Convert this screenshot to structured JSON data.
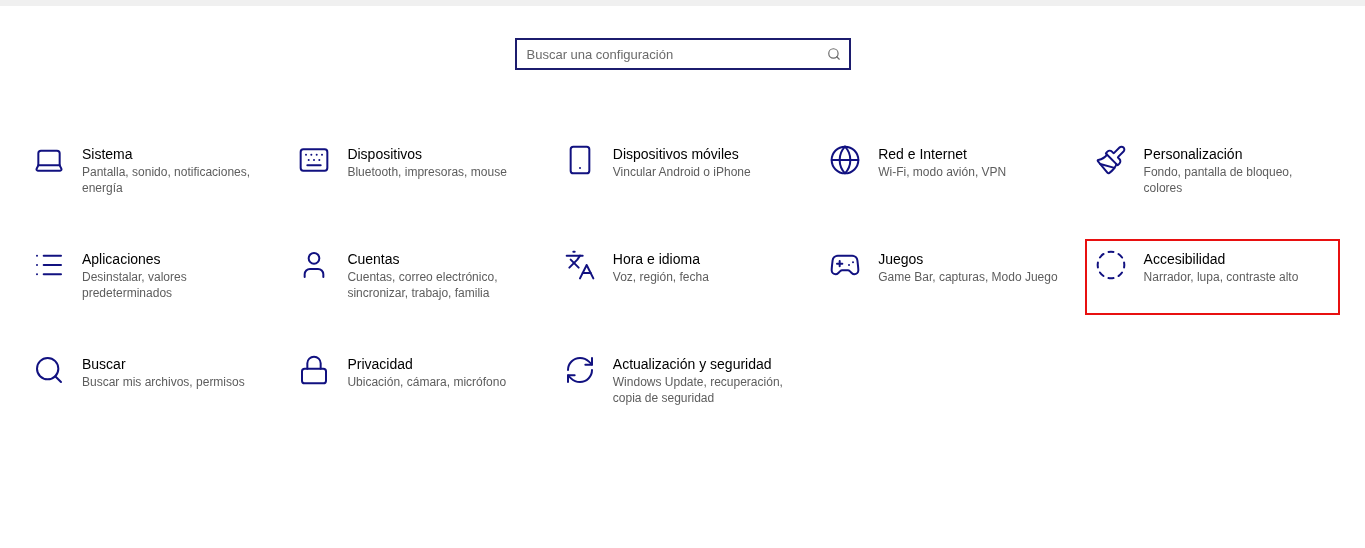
{
  "search": {
    "placeholder": "Buscar una configuración"
  },
  "categories": [
    {
      "title": "Sistema",
      "description": "Pantalla, sonido, notificaciones, energía",
      "highlighted": false
    },
    {
      "title": "Dispositivos",
      "description": "Bluetooth, impresoras, mouse",
      "highlighted": false
    },
    {
      "title": "Dispositivos móviles",
      "description": "Vincular Android o iPhone",
      "highlighted": false
    },
    {
      "title": "Red e Internet",
      "description": "Wi-Fi, modo avión, VPN",
      "highlighted": false
    },
    {
      "title": "Personalización",
      "description": "Fondo, pantalla de bloqueo, colores",
      "highlighted": false
    },
    {
      "title": "Aplicaciones",
      "description": "Desinstalar, valores predeterminados",
      "highlighted": false
    },
    {
      "title": "Cuentas",
      "description": "Cuentas, correo electrónico, sincronizar, trabajo, familia",
      "highlighted": false
    },
    {
      "title": "Hora e idioma",
      "description": "Voz, región, fecha",
      "highlighted": false
    },
    {
      "title": "Juegos",
      "description": "Game Bar, capturas, Modo Juego",
      "highlighted": false
    },
    {
      "title": "Accesibilidad",
      "description": "Narrador, lupa, contraste alto",
      "highlighted": true
    },
    {
      "title": "Buscar",
      "description": "Buscar mis archivos, permisos",
      "highlighted": false
    },
    {
      "title": "Privacidad",
      "description": "Ubicación, cámara, micrófono",
      "highlighted": false
    },
    {
      "title": "Actualización y seguridad",
      "description": "Windows Update, recuperación, copia de seguridad",
      "highlighted": false
    }
  ]
}
